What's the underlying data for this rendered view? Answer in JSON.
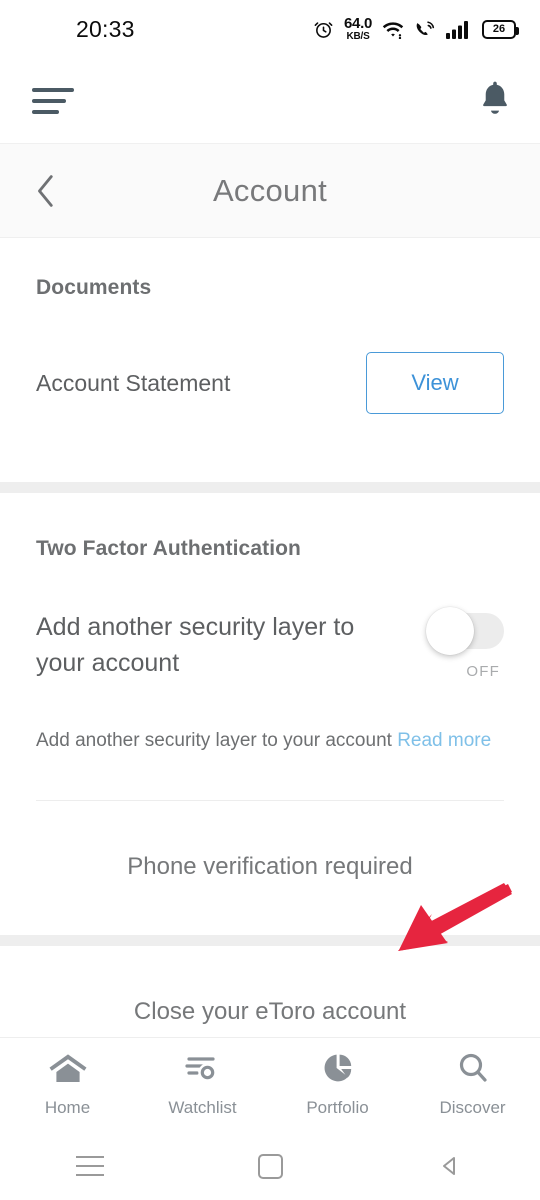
{
  "status_bar": {
    "time": "20:33",
    "alarm_icon": "alarm-clock-icon",
    "network_speed_value": "64.0",
    "network_speed_unit": "KB/S",
    "wifi_icon": "wifi-icon",
    "vowifi_icon": "wifi-calling-icon",
    "signal_icon": "cellular-signal-icon",
    "battery_percent": "26"
  },
  "app_bar": {
    "menu_icon": "hamburger-menu-icon",
    "notifications_icon": "bell-icon"
  },
  "title_bar": {
    "back_icon": "chevron-left-icon",
    "title": "Account"
  },
  "documents": {
    "section_title": "Documents",
    "row_label": "Account Statement",
    "view_button": "View"
  },
  "two_factor": {
    "section_title": "Two Factor Authentication",
    "description": "Add another security layer to your account",
    "toggle_state": "OFF",
    "toggle_on": false,
    "helper_text": "Add another security layer to your account",
    "helper_link": "Read more",
    "phone_verification": "Phone verification required"
  },
  "close_account": {
    "label": "Close your eToro account"
  },
  "annotation": {
    "type": "arrow",
    "color": "#e6253f",
    "points_to": "Close your eToro account"
  },
  "tab_bar": {
    "items": [
      {
        "label": "Home",
        "icon": "home-icon"
      },
      {
        "label": "Watchlist",
        "icon": "watchlist-eye-icon"
      },
      {
        "label": "Portfolio",
        "icon": "pie-chart-icon"
      },
      {
        "label": "Discover",
        "icon": "search-icon"
      }
    ]
  },
  "android_nav": {
    "recents_icon": "recents-icon",
    "home_icon": "home-square-icon",
    "back_icon": "back-triangle-icon"
  },
  "colors": {
    "accent_blue": "#3d92d8",
    "link_blue": "#7fc0e8",
    "annotation_red": "#e6253f",
    "icon_gray": "#8a9096",
    "text_gray": "#5d5f61"
  }
}
